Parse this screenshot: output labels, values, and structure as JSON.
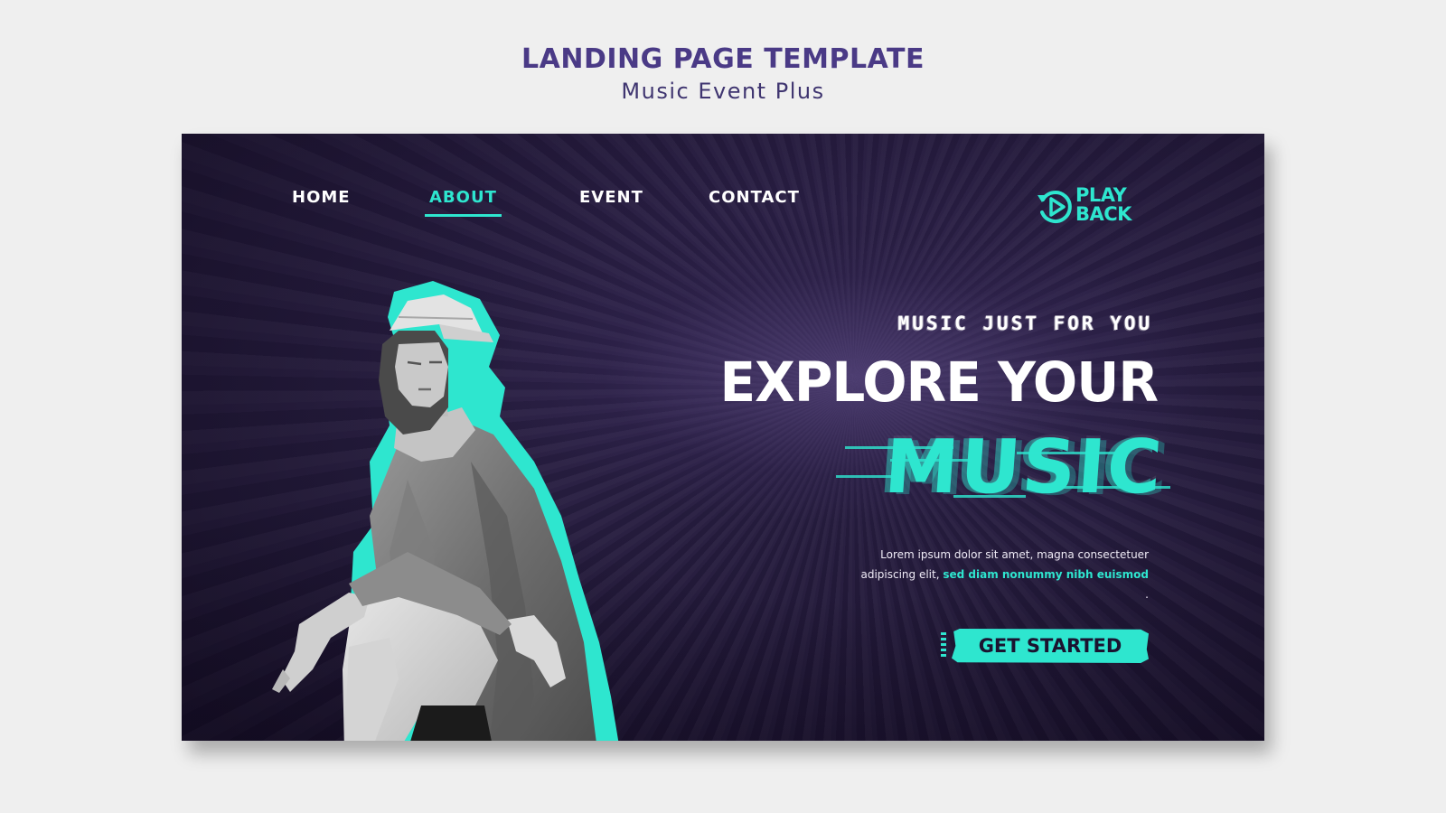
{
  "page": {
    "title": "LANDING PAGE TEMPLATE",
    "subtitle": "Music Event Plus"
  },
  "nav": {
    "items": [
      {
        "label": "HOME",
        "active": false
      },
      {
        "label": "ABOUT",
        "active": true
      },
      {
        "label": "EVENT",
        "active": false
      },
      {
        "label": "CONTACT",
        "active": false
      }
    ]
  },
  "logo": {
    "line1": "PLAY",
    "line2": "BACK",
    "icon": "replay-play-icon"
  },
  "hero": {
    "tagline": "MUSIC JUST FOR YOU",
    "headline_line1": "EXPLORE YOUR",
    "headline_line2": "MUSIC",
    "body_prefix": "Lorem ipsum dolor sit amet, magna consectetuer adipiscing elit,",
    "body_highlight": "sed diam nonummy nibh euismod",
    "body_suffix": ".",
    "cta_label": "GET STARTED"
  },
  "colors": {
    "accent": "#2ee6cf",
    "header_text": "#4a3a86",
    "card_bg": "#1f1634",
    "page_bg": "#efefef"
  }
}
